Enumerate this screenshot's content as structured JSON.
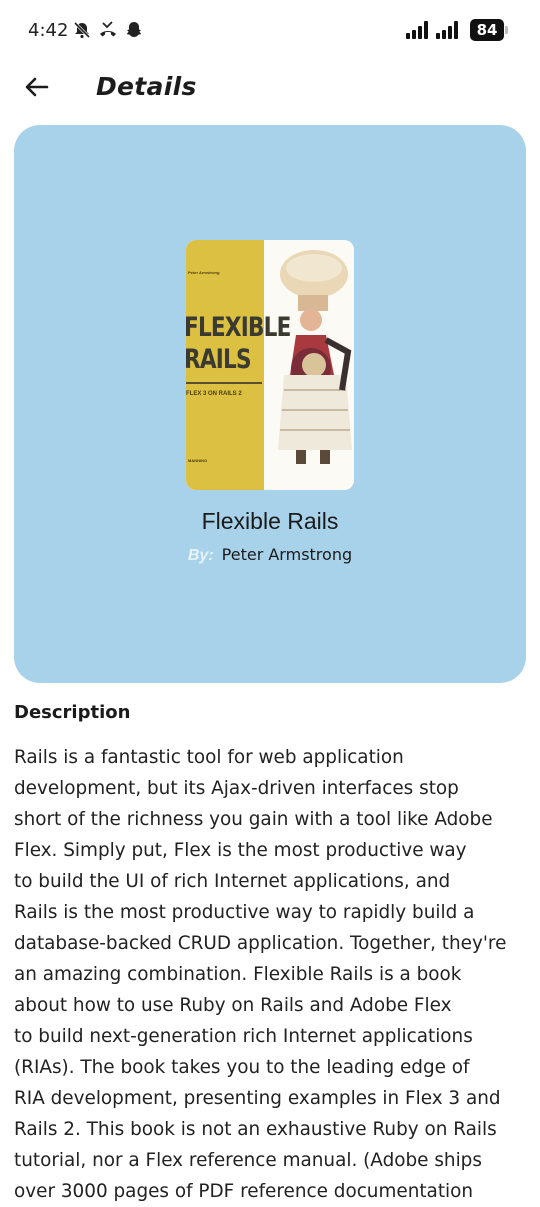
{
  "status_bar": {
    "time": "4:42",
    "battery": "84",
    "left_icons": [
      "notifications-muted-icon",
      "missed-call-icon",
      "snapchat-icon"
    ],
    "right_icons": [
      "signal-bars-icon",
      "signal-bars-icon",
      "battery-icon"
    ]
  },
  "header": {
    "title": "Details",
    "back_icon": "arrow-left-icon"
  },
  "book": {
    "title": "Flexible Rails",
    "author_prefix": "By:",
    "author": "Peter Armstrong",
    "cover": {
      "top_author": "Peter Armstrong",
      "title_line1": "FLEXIBLE",
      "title_line2": "RAILS",
      "subtitle": "FLEX 3 ON RAILS 2",
      "publisher": "MANNING"
    }
  },
  "description": {
    "heading": "Description",
    "text": "Rails is a fantastic tool for web application\ndevelopment, but its Ajax-driven interfaces stop\nshort of the richness you gain with a tool like Adobe\nFlex. Simply put, Flex is the most productive way\nto build the UI of rich Internet applications, and\nRails is the most productive way to rapidly build a\ndatabase-backed CRUD application. Together, they're\nan amazing combination.    Flexible Rails is a book\nabout how to use Ruby on Rails and Adobe Flex\nto build next-generation rich Internet applications\n(RIAs). The book takes you to the leading edge of\nRIA development, presenting examples in Flex 3 and\nRails 2.    This book is not an exhaustive Ruby on Rails\ntutorial, nor a Flex reference manual. (Adobe ships\nover 3000 pages of PDF reference documentation"
  },
  "colors": {
    "hero_background": "#a7d2ea",
    "cover_yellow": "#dcc042",
    "text": "#1f1f1f"
  }
}
